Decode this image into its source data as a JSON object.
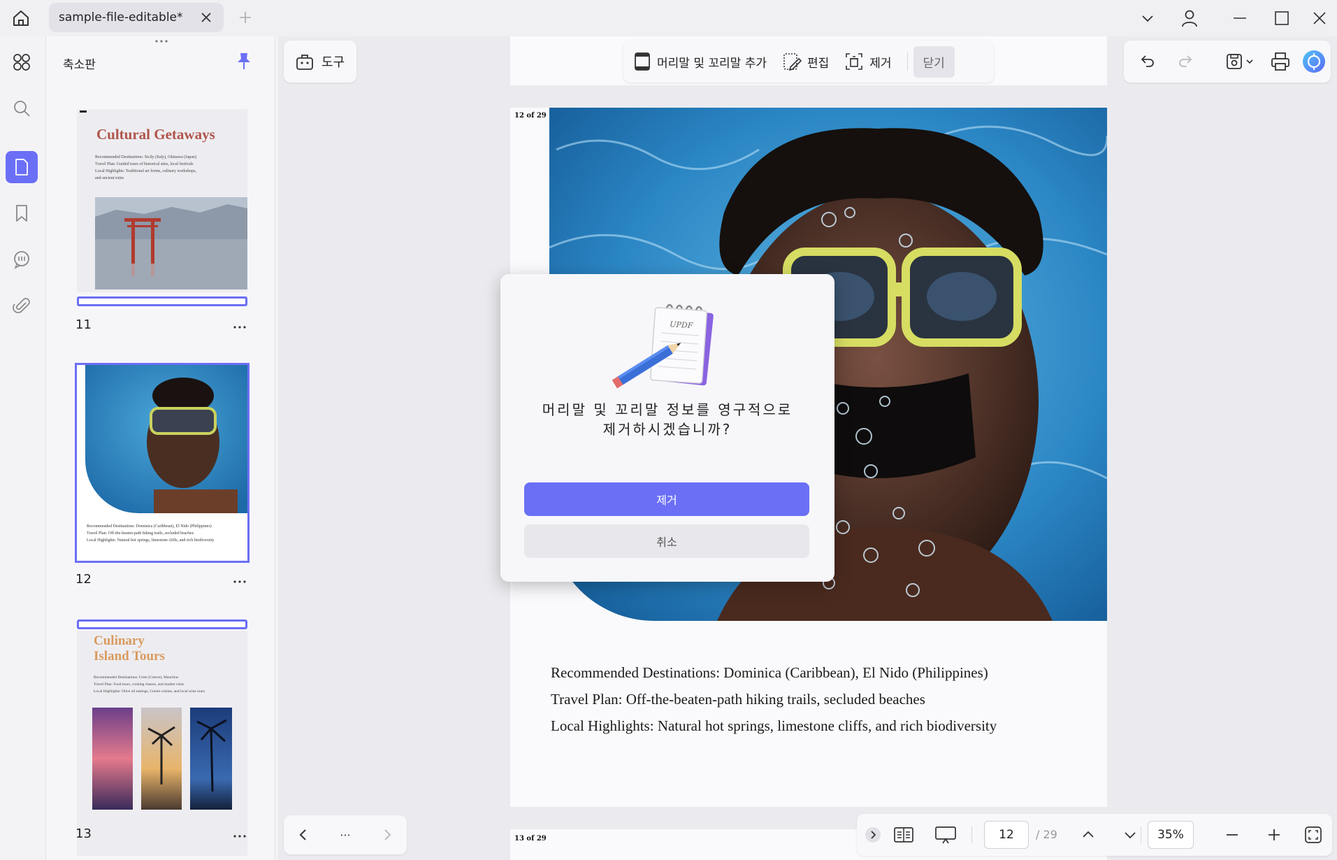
{
  "titlebar": {
    "tab_title": "sample-file-editable*"
  },
  "sidebar": {
    "panel_title": "축소판",
    "thumbnails": [
      {
        "number": "11",
        "heading_line1": "Cultural Getaways",
        "lines": [
          "Recommended Destinations: Sicily (Italy), Okinawa (Japan)",
          "Travel Plan: Guided tours of historical sites, local festivals",
          "Local Highlights: Traditional art forms, culinary workshops,",
          "and ancient ruins"
        ]
      },
      {
        "number": "12",
        "lines": [
          "Recommended Destinations: Dominica (Caribbean), El Nido (Philippines)",
          "Travel Plan: Off-the-beaten-path hiking trails, secluded beaches",
          "Local Highlights: Natural hot springs, limestone cliffs, and rich biodiversity"
        ]
      },
      {
        "number": "13",
        "heading_line1": "Culinary",
        "heading_line2": "Island Tours",
        "lines": [
          "Recommended Destinations: Crete (Greece), Mauritius",
          "Travel Plan: Food tours, cooking classes, and market visits",
          "Local Highlights: Olive oil tastings, Creole cuisine, and local wine tours"
        ]
      }
    ]
  },
  "toolbar": {
    "tools_label": "도구",
    "add_header_footer": "머리말 및 꼬리말 추가",
    "edit": "편집",
    "remove": "제거",
    "close": "닫기"
  },
  "page": {
    "label_current": "12 of 29",
    "label_next": "13 of 29",
    "lines": [
      "Recommended Destinations: Dominica (Caribbean), El Nido (Philippines)",
      "Travel Plan: Off-the-beaten-path hiking trails, secluded beaches",
      "Local Highlights: Natural hot springs, limestone cliffs, and rich biodiversity"
    ]
  },
  "modal": {
    "illustration_text": "UPDF",
    "message_line1": "머리말 및 꼬리말 정보를 영구적으로",
    "message_line2": "제거하시겠습니까?",
    "confirm_label": "제거",
    "cancel_label": "취소"
  },
  "bottom": {
    "page_value": "12",
    "page_total": "/ 29",
    "zoom": "35%",
    "more": "···"
  },
  "colors": {
    "accent": "#6b6ff5"
  }
}
